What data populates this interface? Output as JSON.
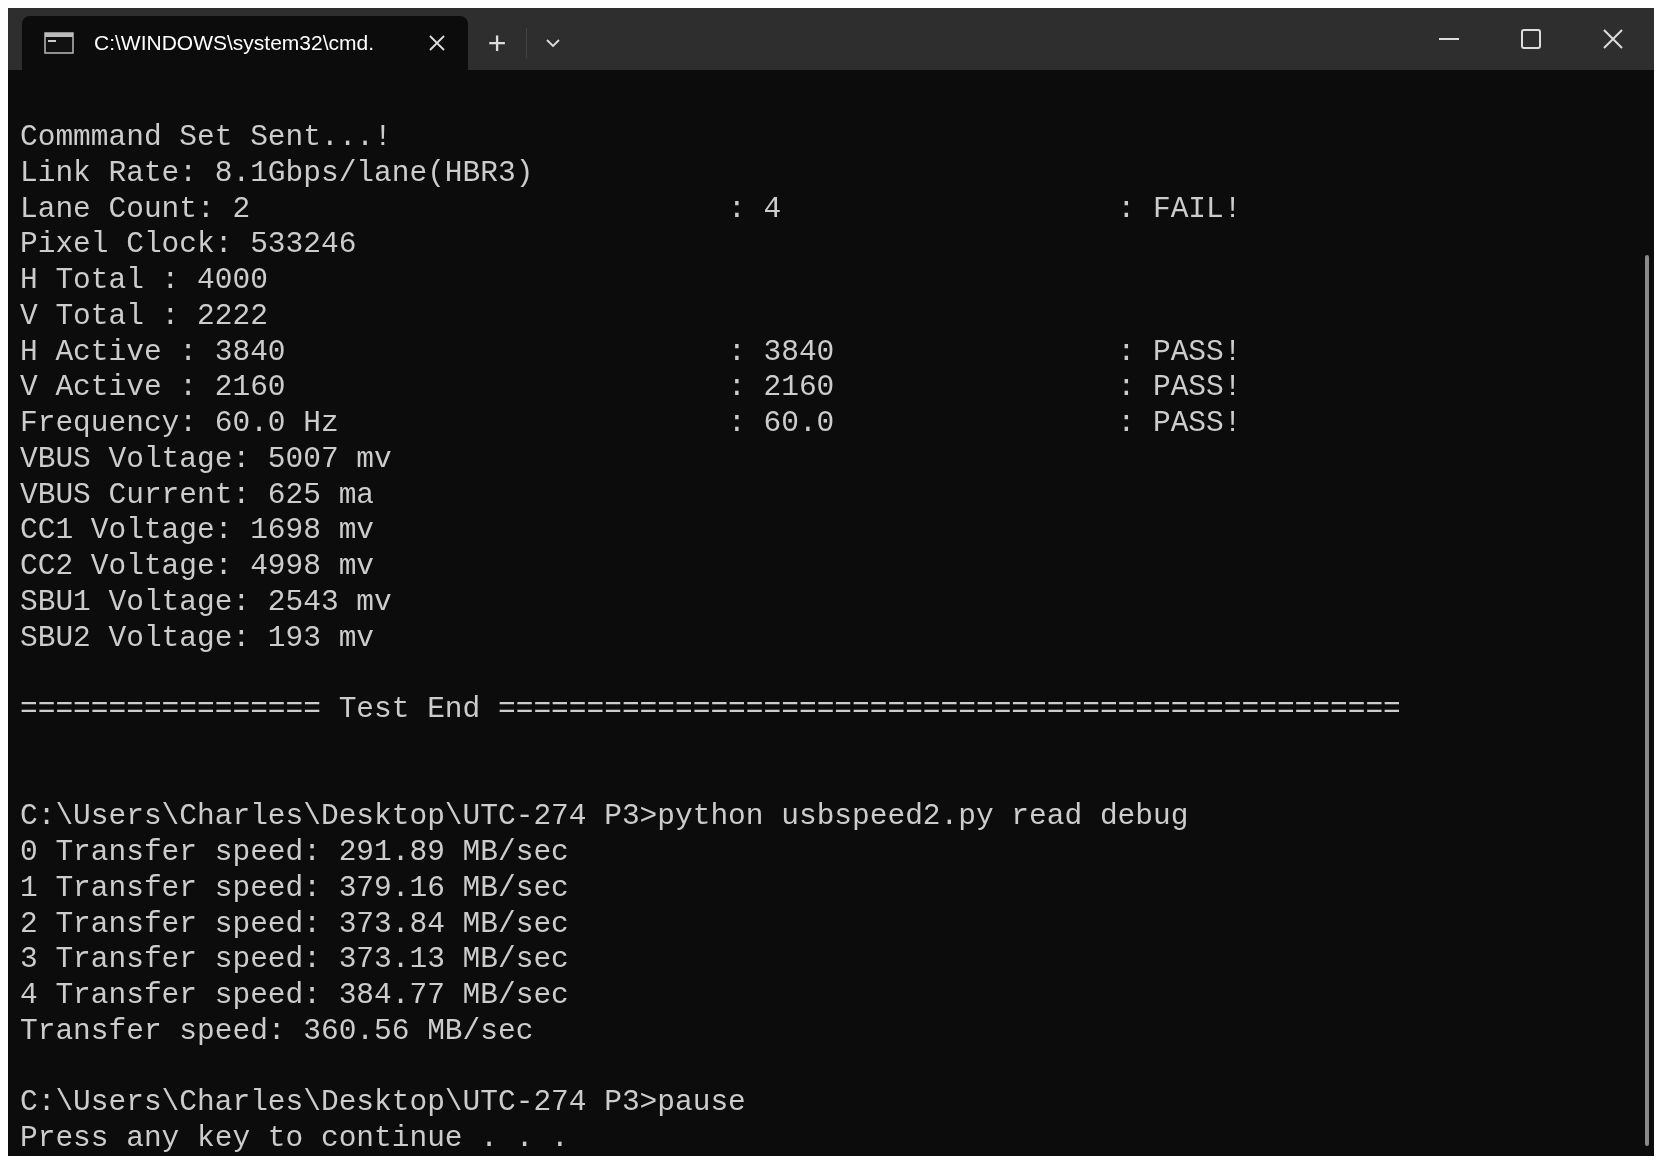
{
  "tab": {
    "title": "C:\\WINDOWS\\system32\\cmd.",
    "selected": true
  },
  "new_tab": "+",
  "lines": [
    {
      "kind": "text",
      "text": "Commmand Set Sent...!"
    },
    {
      "kind": "text",
      "text": "Link Rate: 8.1Gbps/lane(HBR3)"
    },
    {
      "kind": "table",
      "columns": [
        "Lane Count: 2",
        ": 4",
        ": FAIL!"
      ]
    },
    {
      "kind": "text",
      "text": "Pixel Clock: 533246"
    },
    {
      "kind": "text",
      "text": "H Total : 4000"
    },
    {
      "kind": "text",
      "text": "V Total : 2222"
    },
    {
      "kind": "table",
      "columns": [
        "H Active : 3840",
        ": 3840",
        ": PASS!"
      ]
    },
    {
      "kind": "table",
      "columns": [
        "V Active : 2160",
        ": 2160",
        ": PASS!"
      ]
    },
    {
      "kind": "table",
      "columns": [
        "Frequency: 60.0 Hz",
        ": 60.0",
        ": PASS!"
      ]
    },
    {
      "kind": "text",
      "text": "VBUS Voltage: 5007 mv"
    },
    {
      "kind": "text",
      "text": "VBUS Current: 625 ma"
    },
    {
      "kind": "text",
      "text": "CC1 Voltage: 1698 mv"
    },
    {
      "kind": "text",
      "text": "CC2 Voltage: 4998 mv"
    },
    {
      "kind": "text",
      "text": "SBU1 Voltage: 2543 mv"
    },
    {
      "kind": "text",
      "text": "SBU2 Voltage: 193 mv"
    },
    {
      "kind": "blank"
    },
    {
      "kind": "text",
      "text": "================= Test End ==================================================="
    },
    {
      "kind": "blank"
    },
    {
      "kind": "blank"
    },
    {
      "kind": "text",
      "text": "C:\\Users\\Charles\\Desktop\\UTC-274 P3>python usbspeed2.py read debug"
    },
    {
      "kind": "text",
      "text": "0 Transfer speed: 291.89 MB/sec"
    },
    {
      "kind": "text",
      "text": "1 Transfer speed: 379.16 MB/sec"
    },
    {
      "kind": "text",
      "text": "2 Transfer speed: 373.84 MB/sec"
    },
    {
      "kind": "text",
      "text": "3 Transfer speed: 373.13 MB/sec"
    },
    {
      "kind": "text",
      "text": "4 Transfer speed: 384.77 MB/sec"
    },
    {
      "kind": "text",
      "text": "Transfer speed: 360.56 MB/sec"
    },
    {
      "kind": "blank"
    },
    {
      "kind": "text",
      "text": "C:\\Users\\Charles\\Desktop\\UTC-274 P3>pause"
    },
    {
      "kind": "text",
      "text": "Press any key to continue . . ."
    }
  ]
}
